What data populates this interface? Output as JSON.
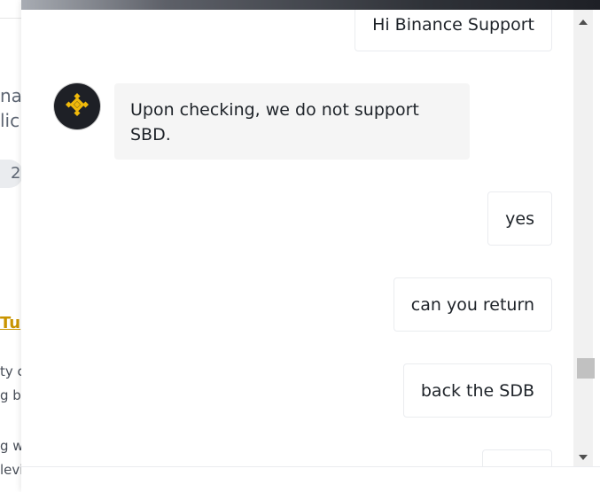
{
  "background_page": {
    "heading_line1": "nat",
    "heading_line2": "lic",
    "pill_text": "2",
    "link_text": "Tu",
    "body_line1": "ty c",
    "body_line2": "g be",
    "body_line3": "g w",
    "body_line4": "levi"
  },
  "chat": {
    "messages": [
      {
        "from": "user",
        "text": "Hi Binance Support"
      },
      {
        "from": "agent",
        "text": "Upon checking, we do not support SBD."
      },
      {
        "from": "user",
        "text": "yes"
      },
      {
        "from": "user",
        "text": "can you return"
      },
      {
        "from": "user",
        "text": "back the SDB"
      },
      {
        "from": "user",
        "text": ""
      }
    ]
  },
  "icons": {
    "avatar": "binance-logo-icon",
    "scroll_up": "triangle-up-icon",
    "scroll_down": "triangle-down-icon"
  },
  "colors": {
    "brand_yellow": "#f0b90b",
    "link_yellow": "#c99400",
    "agent_bubble": "#f5f5f5",
    "avatar_bg": "#1e2026"
  }
}
